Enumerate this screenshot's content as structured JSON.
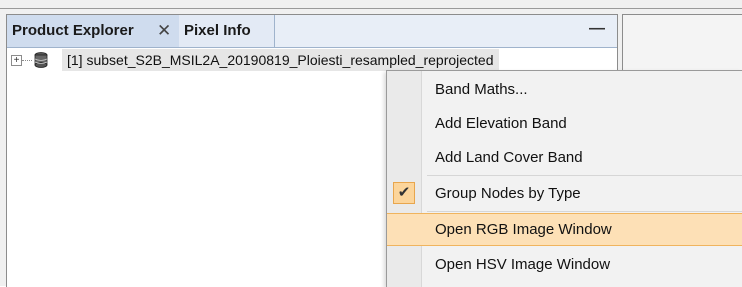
{
  "tabs": [
    {
      "label": "Product Explorer",
      "close": "✕"
    },
    {
      "label": "Pixel Info"
    }
  ],
  "minimize_label": "—",
  "tree": {
    "expander": "+",
    "product_label": "[1] subset_S2B_MSIL2A_20190819_Ploiesti_resampled_reprojected"
  },
  "menu": {
    "items": [
      {
        "label": "Band Maths..."
      },
      {
        "label": "Add Elevation Band"
      },
      {
        "label": "Add Land Cover Band"
      },
      {
        "label": "Group Nodes by Type",
        "checked": true,
        "check_glyph": "✔"
      },
      {
        "label": "Open RGB Image Window",
        "highlighted": true
      },
      {
        "label": "Open HSV Image Window"
      }
    ]
  },
  "colors": {
    "tab_active": "#cfdcee",
    "menu_highlight": "#fde0b6",
    "menu_highlight_border": "#f0b45e",
    "check_bg": "#fcd59b"
  }
}
